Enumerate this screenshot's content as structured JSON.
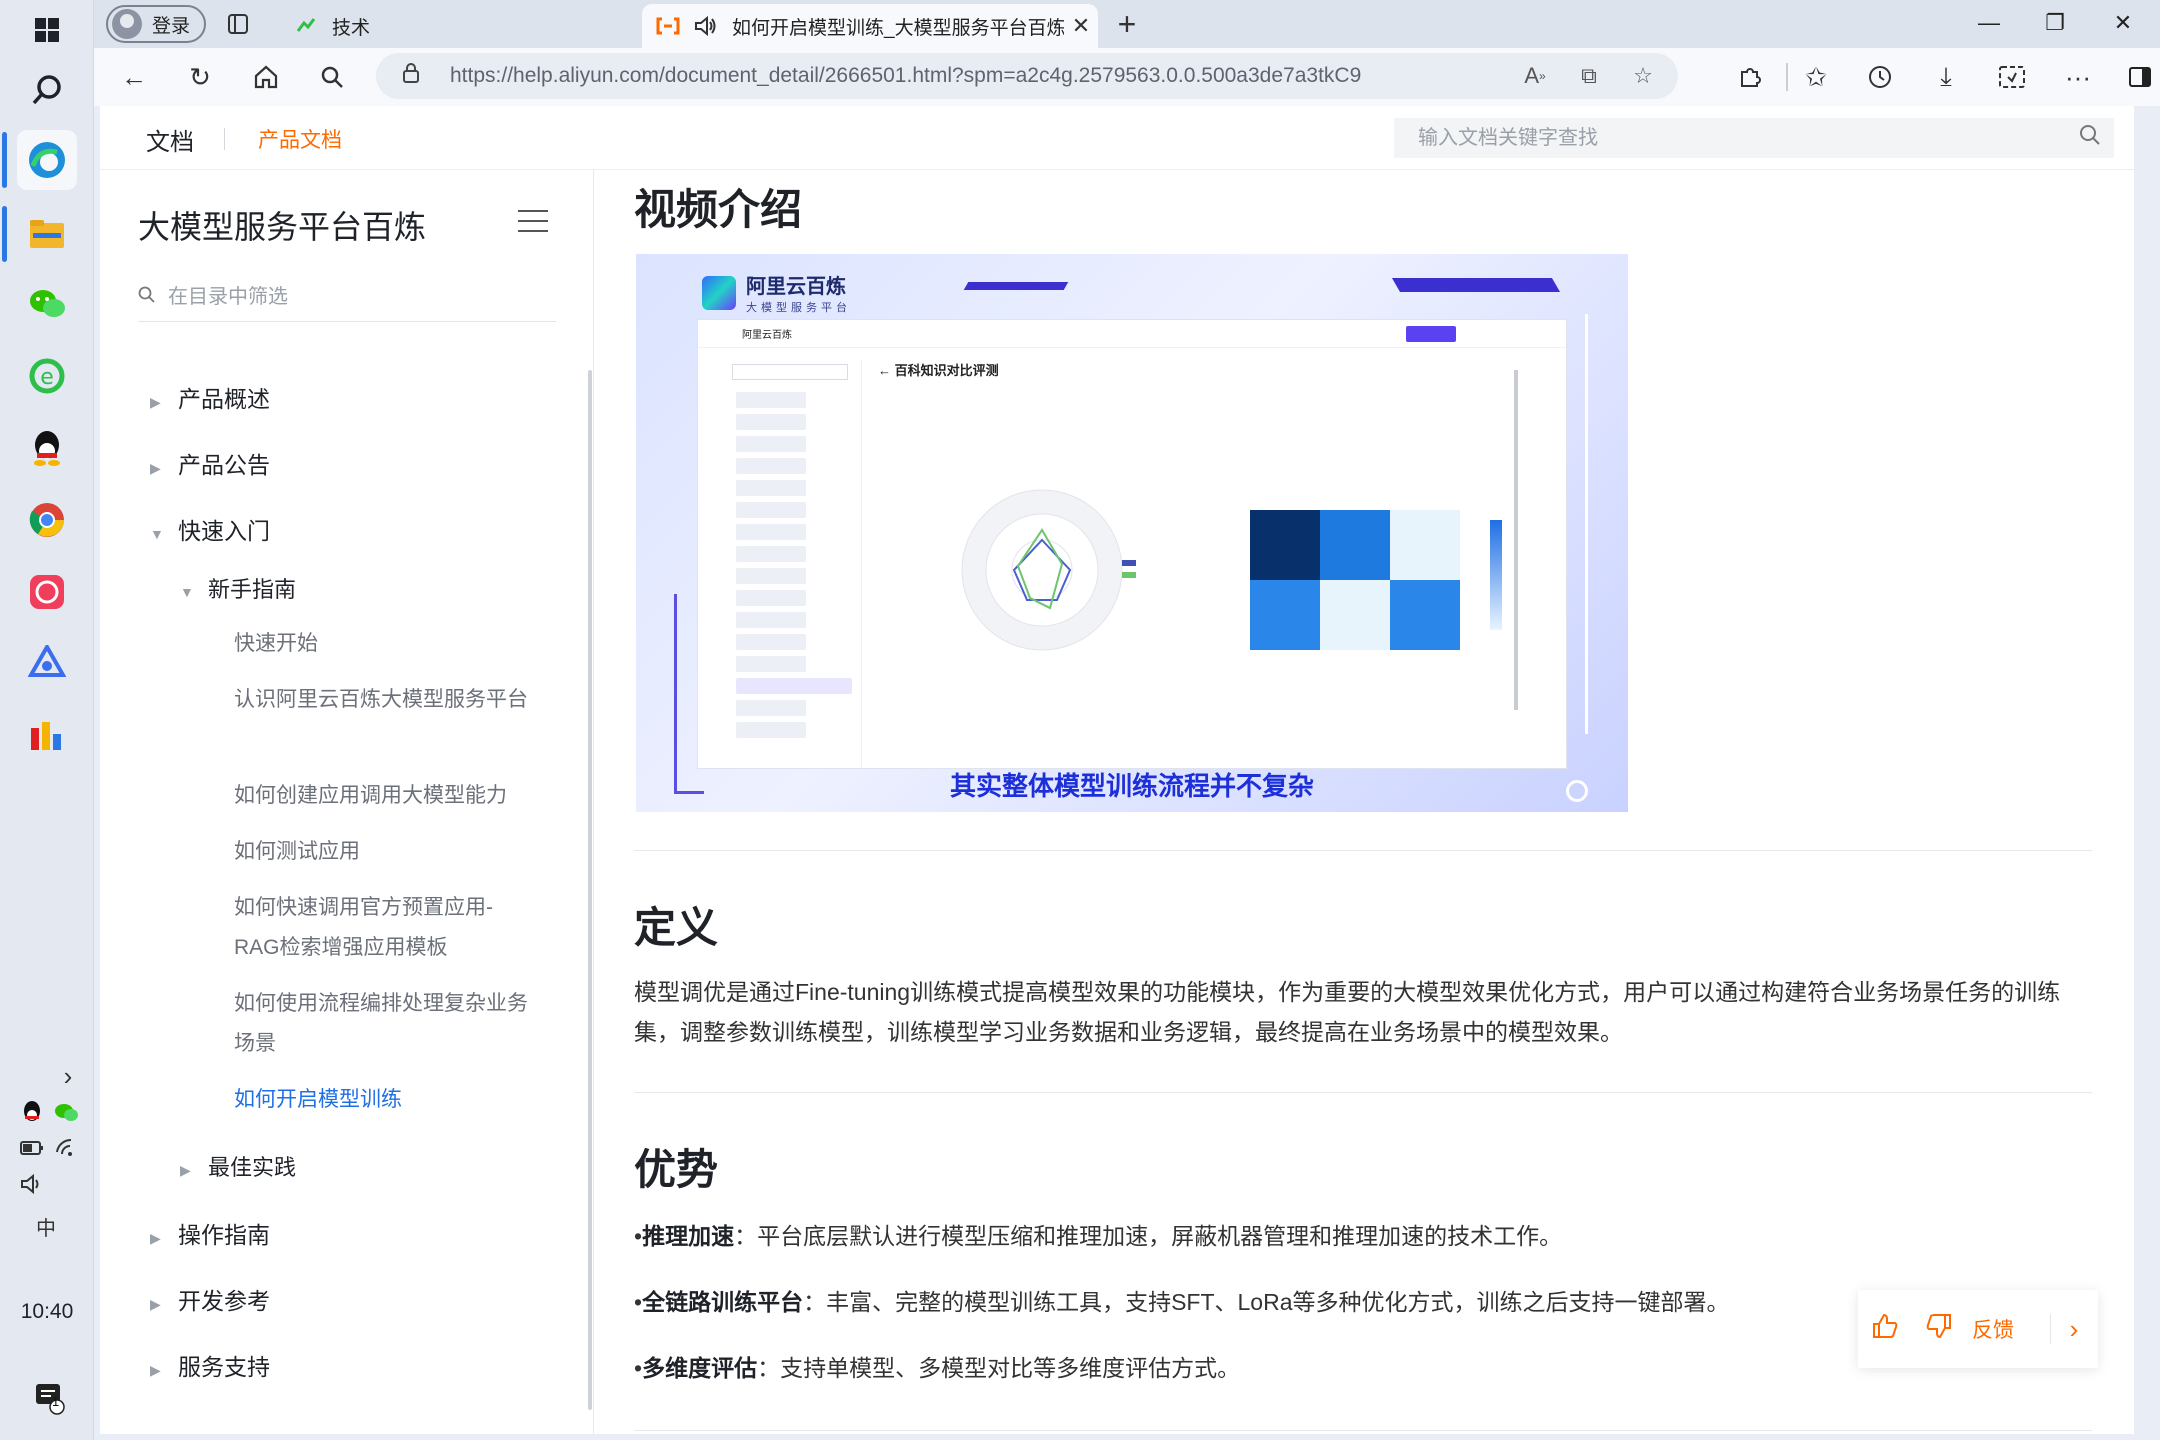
{
  "browser": {
    "profile_label": "登录",
    "tabs": [
      {
        "title": "技术",
        "icon": "tech-favicon"
      },
      {
        "title": "如何开启模型训练_大模型服务平台百炼",
        "icon": "aliyun-favicon",
        "audio_icon": "speaker-icon"
      }
    ],
    "url_host": "https://help.aliyun.com",
    "url_path": "/document_detail/2666501.html?spm=a2c4g.2579563.0.0.500a3de7a3tkC9"
  },
  "topnav": {
    "docs": "文档",
    "product_docs": "产品文档",
    "search_placeholder": "输入文档关键字查找"
  },
  "sidebar": {
    "title": "大模型服务平台百炼",
    "filter_placeholder": "在目录中筛选",
    "items": [
      {
        "label": "产品概述"
      },
      {
        "label": "产品公告"
      },
      {
        "label": "快速入门"
      },
      {
        "label": "新手指南"
      },
      {
        "label": "快速开始"
      },
      {
        "label": "认识阿里云百炼大模型服务平台"
      },
      {
        "label": "如何创建应用调用大模型能力"
      },
      {
        "label": "如何测试应用"
      },
      {
        "label": "如何快速调用官方预置应用-RAG检索增强应用模板"
      },
      {
        "label": "如何使用流程编排处理复杂业务场景"
      },
      {
        "label": "如何开启模型训练"
      },
      {
        "label": "最佳实践"
      },
      {
        "label": "操作指南"
      },
      {
        "label": "开发参考"
      },
      {
        "label": "服务支持"
      }
    ]
  },
  "content": {
    "video_heading": "视频介绍",
    "video": {
      "logo_main": "阿里云百炼",
      "logo_sub": "大模型服务平台",
      "screen_title": "百科知识对比评测",
      "caption": "其实整体模型训练流程并不复杂"
    },
    "def_heading": "定义",
    "def_text": "模型调优是通过Fine-tuning训练模式提高模型效果的功能模块，作为重要的大模型效果优化方式，用户可以通过构建符合业务场景任务的训练集，调整参数训练模型，训练模型学习业务数据和业务逻辑，最终提高在业务场景中的模型效果。",
    "adv_heading": "优势",
    "advantages": [
      {
        "title": "推理加速",
        "text": "：平台底层默认进行模型压缩和推理加速，屏蔽机器管理和推理加速的技术工作。"
      },
      {
        "title": "全链路训练平台",
        "text": "：丰富、完整的模型训练工具，支持SFT、LoRa等多种优化方式，训练之后支持一键部署。"
      },
      {
        "title": "多维度评估",
        "text": "：支持单模型、多模型对比等多维度评估方式。"
      }
    ]
  },
  "feedback": {
    "label": "反馈"
  },
  "taskbar": {
    "time": "10:40",
    "ime": "中",
    "notification_count": "1"
  },
  "colors": {
    "accent": "#ff6a00",
    "link": "#1f6fe5",
    "caption": "#1d2fd8"
  }
}
